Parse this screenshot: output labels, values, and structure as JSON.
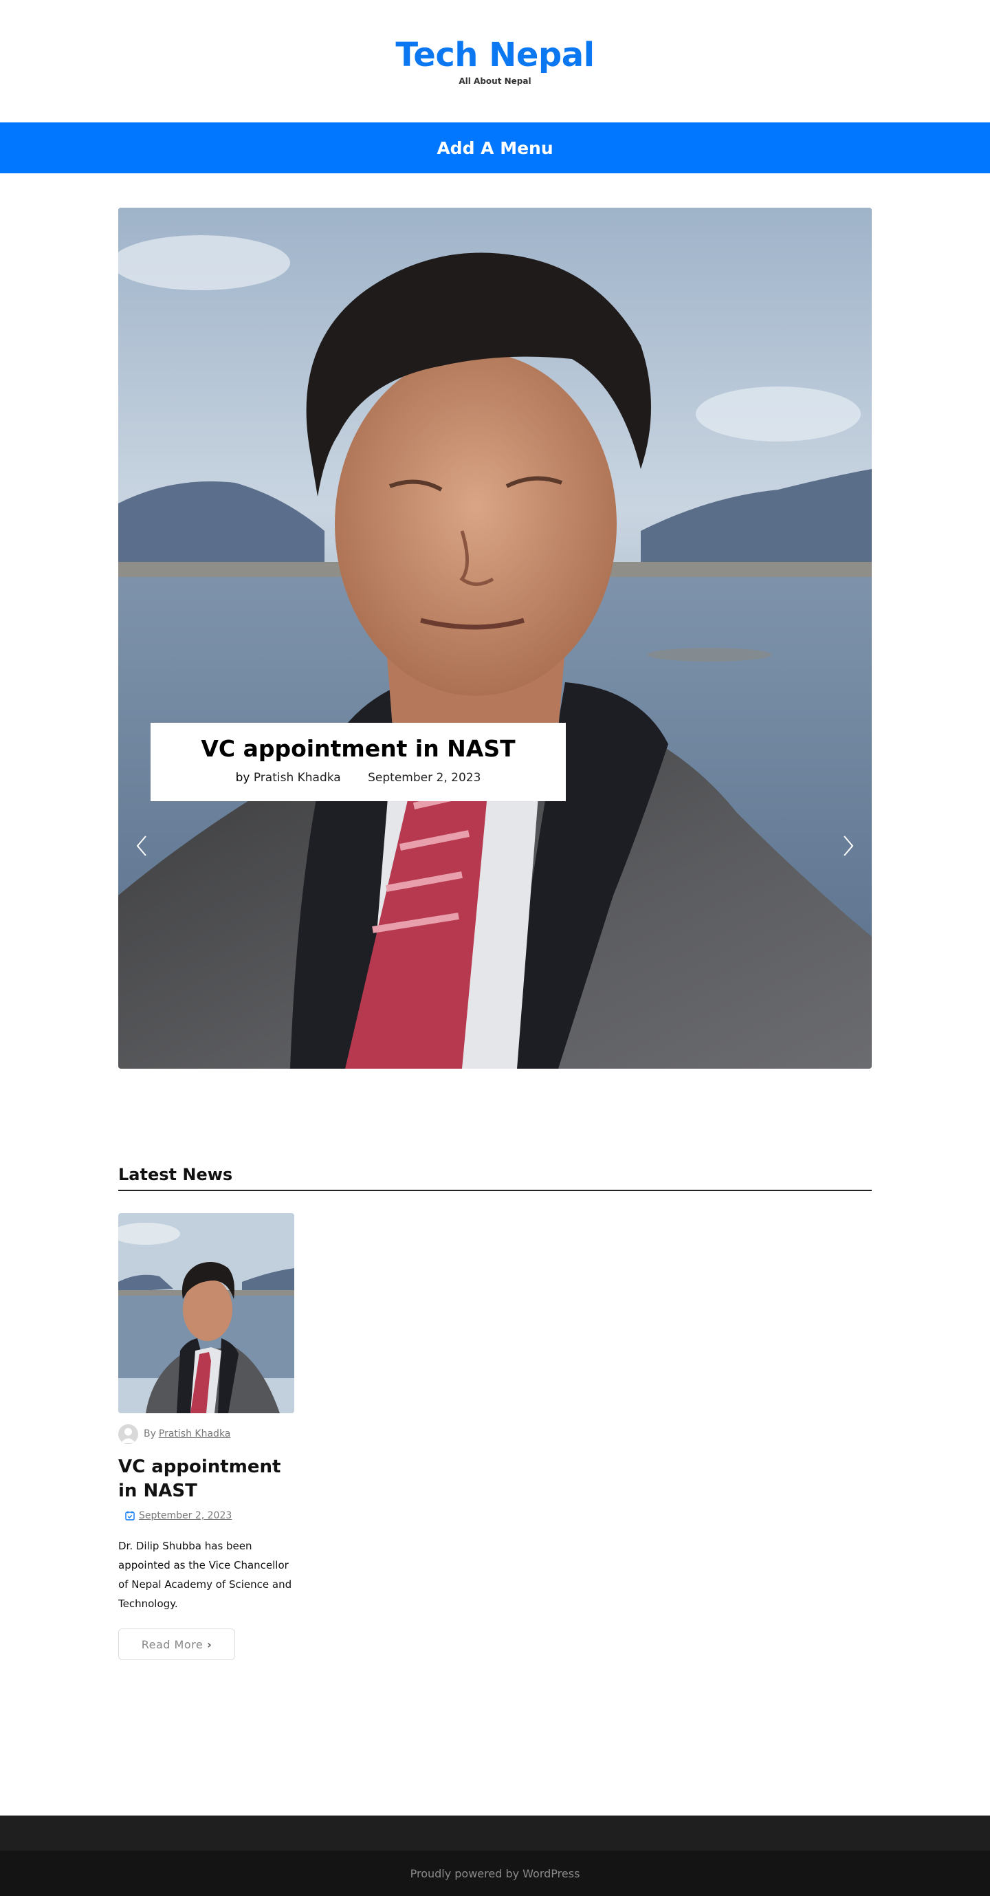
{
  "header": {
    "site_title": "Tech Nepal",
    "tagline": "All About Nepal"
  },
  "nav": {
    "menu_label": "Add A Menu"
  },
  "slider": {
    "slide": {
      "title": "VC appointment in NAST",
      "by_label": "by",
      "author": "Pratish Khadka",
      "date": "September 2, 2023"
    },
    "prev_icon": "chevron-left-icon",
    "next_icon": "chevron-right-icon"
  },
  "latest_news": {
    "heading": "Latest News",
    "posts": [
      {
        "by_label": "By",
        "author": "Pratish Khadka",
        "title": "VC appointment in NAST",
        "date": "September 2, 2023",
        "excerpt": "Dr. Dilip Shubba has been appointed as the Vice Chancellor of Nepal Academy of Science and Technology.",
        "read_more_label": "Read More",
        "date_icon": "calendar-icon"
      }
    ]
  },
  "footer": {
    "credit": "Proudly powered by WordPress"
  },
  "colors": {
    "brand": "#0077fe",
    "footer_top": "#1f1f1f",
    "footer_bottom": "#141414"
  }
}
